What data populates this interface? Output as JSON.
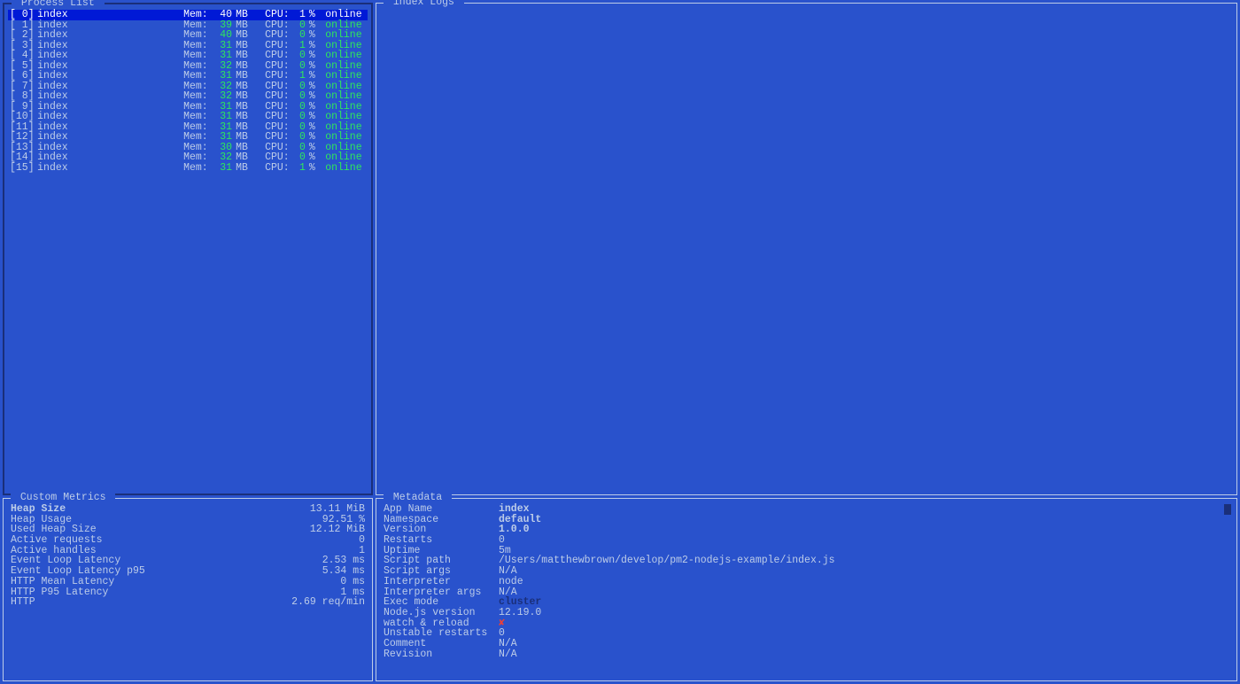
{
  "panels": {
    "process_list_title": " Process List ",
    "logs_title": " index Logs ",
    "metrics_title": " Custom Metrics ",
    "metadata_title": " Metadata "
  },
  "processes": [
    {
      "id": "[ 0]",
      "name": "index",
      "mem_lbl": "Mem:",
      "mem_val": "40",
      "mem_unit": "MB",
      "cpu_lbl": "CPU:",
      "cpu_val": "1",
      "cpu_unit": "%",
      "status": "online",
      "selected": true
    },
    {
      "id": "[ 1]",
      "name": "index",
      "mem_lbl": "Mem:",
      "mem_val": "39",
      "mem_unit": "MB",
      "cpu_lbl": "CPU:",
      "cpu_val": "0",
      "cpu_unit": "%",
      "status": "online",
      "selected": false
    },
    {
      "id": "[ 2]",
      "name": "index",
      "mem_lbl": "Mem:",
      "mem_val": "40",
      "mem_unit": "MB",
      "cpu_lbl": "CPU:",
      "cpu_val": "0",
      "cpu_unit": "%",
      "status": "online",
      "selected": false
    },
    {
      "id": "[ 3]",
      "name": "index",
      "mem_lbl": "Mem:",
      "mem_val": "31",
      "mem_unit": "MB",
      "cpu_lbl": "CPU:",
      "cpu_val": "1",
      "cpu_unit": "%",
      "status": "online",
      "selected": false
    },
    {
      "id": "[ 4]",
      "name": "index",
      "mem_lbl": "Mem:",
      "mem_val": "31",
      "mem_unit": "MB",
      "cpu_lbl": "CPU:",
      "cpu_val": "0",
      "cpu_unit": "%",
      "status": "online",
      "selected": false
    },
    {
      "id": "[ 5]",
      "name": "index",
      "mem_lbl": "Mem:",
      "mem_val": "32",
      "mem_unit": "MB",
      "cpu_lbl": "CPU:",
      "cpu_val": "0",
      "cpu_unit": "%",
      "status": "online",
      "selected": false
    },
    {
      "id": "[ 6]",
      "name": "index",
      "mem_lbl": "Mem:",
      "mem_val": "31",
      "mem_unit": "MB",
      "cpu_lbl": "CPU:",
      "cpu_val": "1",
      "cpu_unit": "%",
      "status": "online",
      "selected": false
    },
    {
      "id": "[ 7]",
      "name": "index",
      "mem_lbl": "Mem:",
      "mem_val": "32",
      "mem_unit": "MB",
      "cpu_lbl": "CPU:",
      "cpu_val": "0",
      "cpu_unit": "%",
      "status": "online",
      "selected": false
    },
    {
      "id": "[ 8]",
      "name": "index",
      "mem_lbl": "Mem:",
      "mem_val": "32",
      "mem_unit": "MB",
      "cpu_lbl": "CPU:",
      "cpu_val": "0",
      "cpu_unit": "%",
      "status": "online",
      "selected": false
    },
    {
      "id": "[ 9]",
      "name": "index",
      "mem_lbl": "Mem:",
      "mem_val": "31",
      "mem_unit": "MB",
      "cpu_lbl": "CPU:",
      "cpu_val": "0",
      "cpu_unit": "%",
      "status": "online",
      "selected": false
    },
    {
      "id": "[10]",
      "name": "index",
      "mem_lbl": "Mem:",
      "mem_val": "31",
      "mem_unit": "MB",
      "cpu_lbl": "CPU:",
      "cpu_val": "0",
      "cpu_unit": "%",
      "status": "online",
      "selected": false
    },
    {
      "id": "[11]",
      "name": "index",
      "mem_lbl": "Mem:",
      "mem_val": "31",
      "mem_unit": "MB",
      "cpu_lbl": "CPU:",
      "cpu_val": "0",
      "cpu_unit": "%",
      "status": "online",
      "selected": false
    },
    {
      "id": "[12]",
      "name": "index",
      "mem_lbl": "Mem:",
      "mem_val": "31",
      "mem_unit": "MB",
      "cpu_lbl": "CPU:",
      "cpu_val": "0",
      "cpu_unit": "%",
      "status": "online",
      "selected": false
    },
    {
      "id": "[13]",
      "name": "index",
      "mem_lbl": "Mem:",
      "mem_val": "30",
      "mem_unit": "MB",
      "cpu_lbl": "CPU:",
      "cpu_val": "0",
      "cpu_unit": "%",
      "status": "online",
      "selected": false
    },
    {
      "id": "[14]",
      "name": "index",
      "mem_lbl": "Mem:",
      "mem_val": "32",
      "mem_unit": "MB",
      "cpu_lbl": "CPU:",
      "cpu_val": "0",
      "cpu_unit": "%",
      "status": "online",
      "selected": false
    },
    {
      "id": "[15]",
      "name": "index",
      "mem_lbl": "Mem:",
      "mem_val": "31",
      "mem_unit": "MB",
      "cpu_lbl": "CPU:",
      "cpu_val": "1",
      "cpu_unit": "%",
      "status": "online",
      "selected": false
    }
  ],
  "metrics": [
    {
      "label": "Heap Size",
      "value": "13.11 MiB",
      "bold": true
    },
    {
      "label": "Heap Usage",
      "value": "92.51 %",
      "bold": false
    },
    {
      "label": "Used Heap Size",
      "value": "12.12 MiB",
      "bold": false
    },
    {
      "label": "Active requests",
      "value": "0",
      "bold": false
    },
    {
      "label": "Active handles",
      "value": "1",
      "bold": false
    },
    {
      "label": "Event Loop Latency",
      "value": "2.53 ms",
      "bold": false
    },
    {
      "label": "Event Loop Latency p95",
      "value": "5.34 ms",
      "bold": false
    },
    {
      "label": "HTTP Mean Latency",
      "value": "0 ms",
      "bold": false
    },
    {
      "label": "HTTP P95 Latency",
      "value": "1 ms",
      "bold": false
    },
    {
      "label": "HTTP",
      "value": "2.69 req/min",
      "bold": false
    }
  ],
  "metadata": [
    {
      "label": "App Name",
      "value": "index",
      "style": "bold"
    },
    {
      "label": "Namespace",
      "value": "default",
      "style": "bold"
    },
    {
      "label": "Version",
      "value": "1.0.0",
      "style": "bold"
    },
    {
      "label": "Restarts",
      "value": "0",
      "style": ""
    },
    {
      "label": "Uptime",
      "value": "5m",
      "style": ""
    },
    {
      "label": "Script path",
      "value": "/Users/matthewbrown/develop/pm2-nodejs-example/index.js",
      "style": ""
    },
    {
      "label": "Script args",
      "value": "N/A",
      "style": ""
    },
    {
      "label": "Interpreter",
      "value": "node",
      "style": ""
    },
    {
      "label": "Interpreter args",
      "value": "N/A",
      "style": ""
    },
    {
      "label": "Exec mode",
      "value": "cluster",
      "style": "blue"
    },
    {
      "label": "Node.js version",
      "value": "12.19.0",
      "style": ""
    },
    {
      "label": "watch & reload",
      "value": "✘",
      "style": "red"
    },
    {
      "label": "Unstable restarts",
      "value": "0",
      "style": ""
    },
    {
      "label": "Comment",
      "value": "N/A",
      "style": ""
    },
    {
      "label": "Revision",
      "value": "N/A",
      "style": ""
    }
  ]
}
